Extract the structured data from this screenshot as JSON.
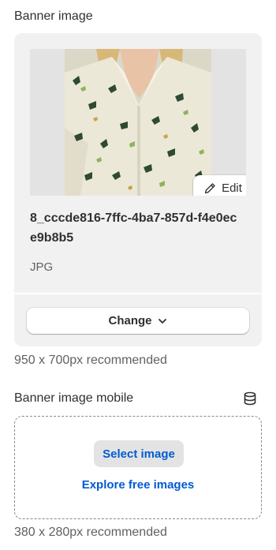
{
  "banner": {
    "label": "Banner image",
    "image_alt": "Cream shirt with butterfly print",
    "edit_label": "Edit",
    "filename": "8_cccde816-7ffc-4ba7-857d-f4e0ece9b8b5",
    "filetype": "JPG",
    "change_label": "Change",
    "recommendation": "950 x 700px recommended"
  },
  "banner_mobile": {
    "label": "Banner image mobile",
    "select_label": "Select image",
    "explore_label": "Explore free images",
    "recommendation": "380 x 280px recommended"
  },
  "colors": {
    "link": "#005bd3",
    "card_bg": "#f1f1f1",
    "secondary_text": "#616161"
  },
  "icons": {
    "edit": "pencil-icon",
    "change": "chevron-down-icon",
    "dynamic_source": "database-icon"
  }
}
